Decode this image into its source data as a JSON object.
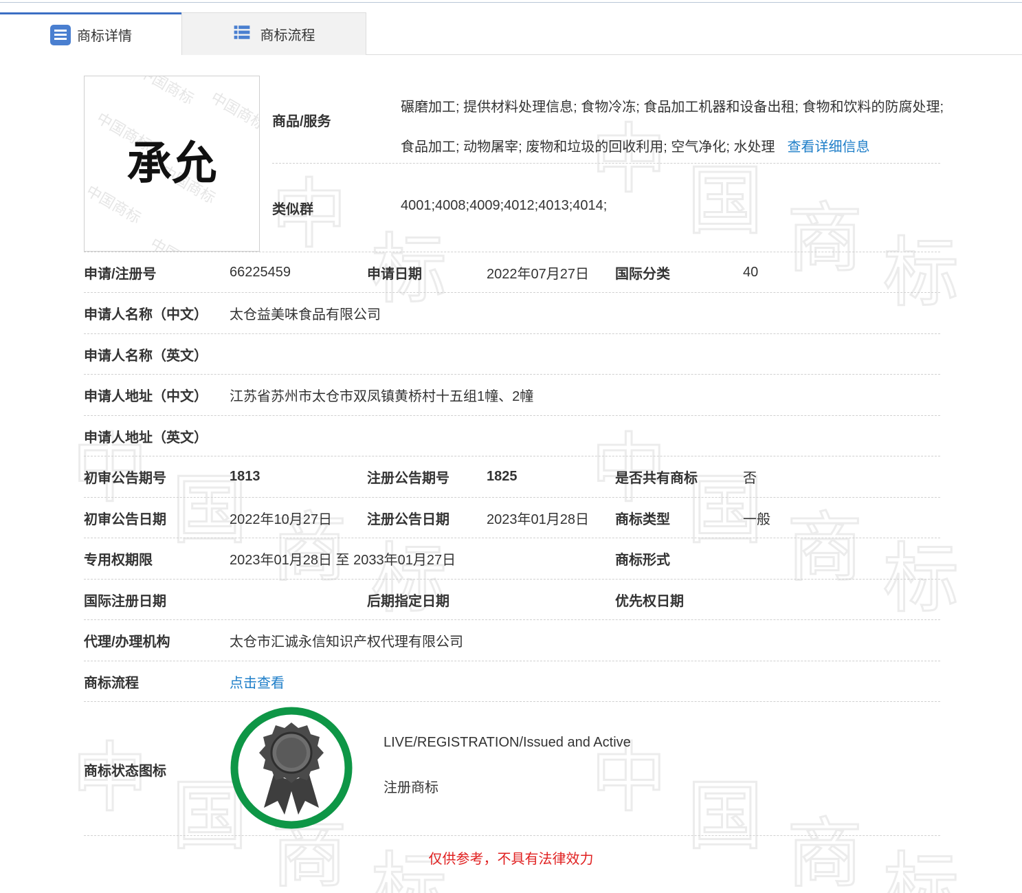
{
  "tabs": [
    {
      "label": "商标详情",
      "icon": "document-list-icon",
      "active": true
    },
    {
      "label": "商标流程",
      "icon": "list-icon",
      "active": false
    }
  ],
  "trademark": {
    "mark_text": "承允",
    "watermark_text": "中国商标"
  },
  "goods": {
    "label": "商品/服务",
    "text": "碾磨加工; 提供材料处理信息; 食物冷冻; 食品加工机器和设备出租; 食物和饮料的防腐处理; 食品加工; 动物屠宰; 废物和垃圾的回收利用; 空气净化; 水处理",
    "link_label": "查看详细信息"
  },
  "similar_group": {
    "label": "类似群",
    "value": "4001;4008;4009;4012;4013;4014;"
  },
  "rows": {
    "reg_no_label": "申请/注册号",
    "reg_no": "66225459",
    "apply_date_label": "申请日期",
    "apply_date": "2022年07月27日",
    "intl_class_label": "国际分类",
    "intl_class": "40",
    "applicant_cn_label": "申请人名称（中文）",
    "applicant_cn": "太仓益美味食品有限公司",
    "applicant_en_label": "申请人名称（英文）",
    "applicant_en": "",
    "address_cn_label": "申请人地址（中文）",
    "address_cn": "江苏省苏州市太仓市双凤镇黄桥村十五组1幢、2幢",
    "address_en_label": "申请人地址（英文）",
    "address_en": "",
    "prelim_issue_label": "初审公告期号",
    "prelim_issue": "1813",
    "reg_issue_label": "注册公告期号",
    "reg_issue": "1825",
    "shared_label": "是否共有商标",
    "shared": "否",
    "prelim_date_label": "初审公告日期",
    "prelim_date": "2022年10月27日",
    "reg_date_label": "注册公告日期",
    "reg_date": "2023年01月28日",
    "tm_type_label": "商标类型",
    "tm_type": "一般",
    "term_label": "专用权期限",
    "term": "2023年01月28日 至 2033年01月27日",
    "tm_form_label": "商标形式",
    "tm_form": "",
    "intl_reg_date_label": "国际注册日期",
    "intl_reg_date": "",
    "later_date_label": "后期指定日期",
    "later_date": "",
    "priority_date_label": "优先权日期",
    "priority_date": "",
    "agency_label": "代理/办理机构",
    "agency": "太仓市汇诚永信知识产权代理有限公司",
    "flow_label": "商标流程",
    "flow_link": "点击查看"
  },
  "status": {
    "label": "商标状态图标",
    "icon": "award-ribbon-icon",
    "ring_color": "#0e9646",
    "en": "LIVE/REGISTRATION/Issued and Active",
    "cn": "注册商标"
  },
  "disclaimer": "仅供参考，不具有法律效力",
  "colors": {
    "link": "#1e7ec8",
    "accent": "#3b6fc4",
    "warning": "#e02020"
  }
}
